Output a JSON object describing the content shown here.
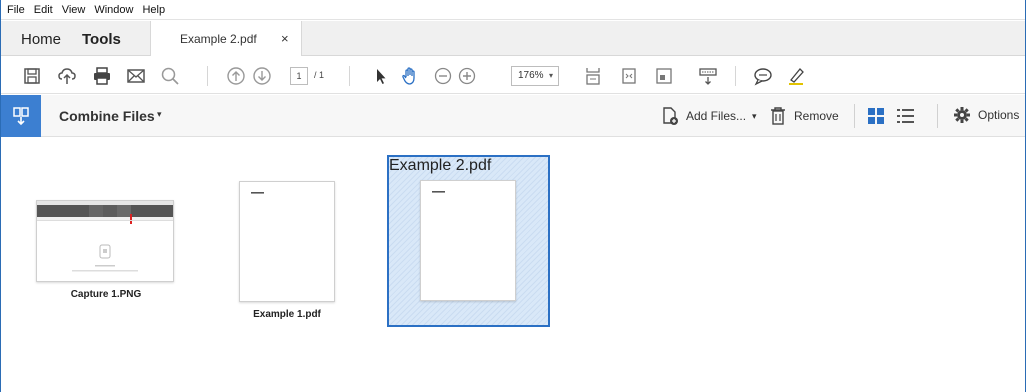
{
  "menu": [
    "File",
    "Edit",
    "View",
    "Window",
    "Help"
  ],
  "tabs": {
    "home": "Home",
    "tools": "Tools",
    "document": "Example 2.pdf",
    "close": "×"
  },
  "toolbar": {
    "page_current": "1",
    "page_total": "/ 1",
    "zoom": "176%",
    "zoom_caret": "▾"
  },
  "combine": {
    "title": "Combine Files",
    "title_caret": "▾",
    "add_files": "Add Files...",
    "add_files_caret": "▾",
    "remove": "Remove",
    "options": "Options"
  },
  "files": [
    {
      "name": "Capture 1.PNG",
      "selected": false
    },
    {
      "name": "Example 1.pdf",
      "selected": false
    },
    {
      "name": "Example 2.pdf",
      "selected": true
    }
  ],
  "colors": {
    "accent": "#3c7fd1",
    "selection_border": "#2b70c4"
  }
}
